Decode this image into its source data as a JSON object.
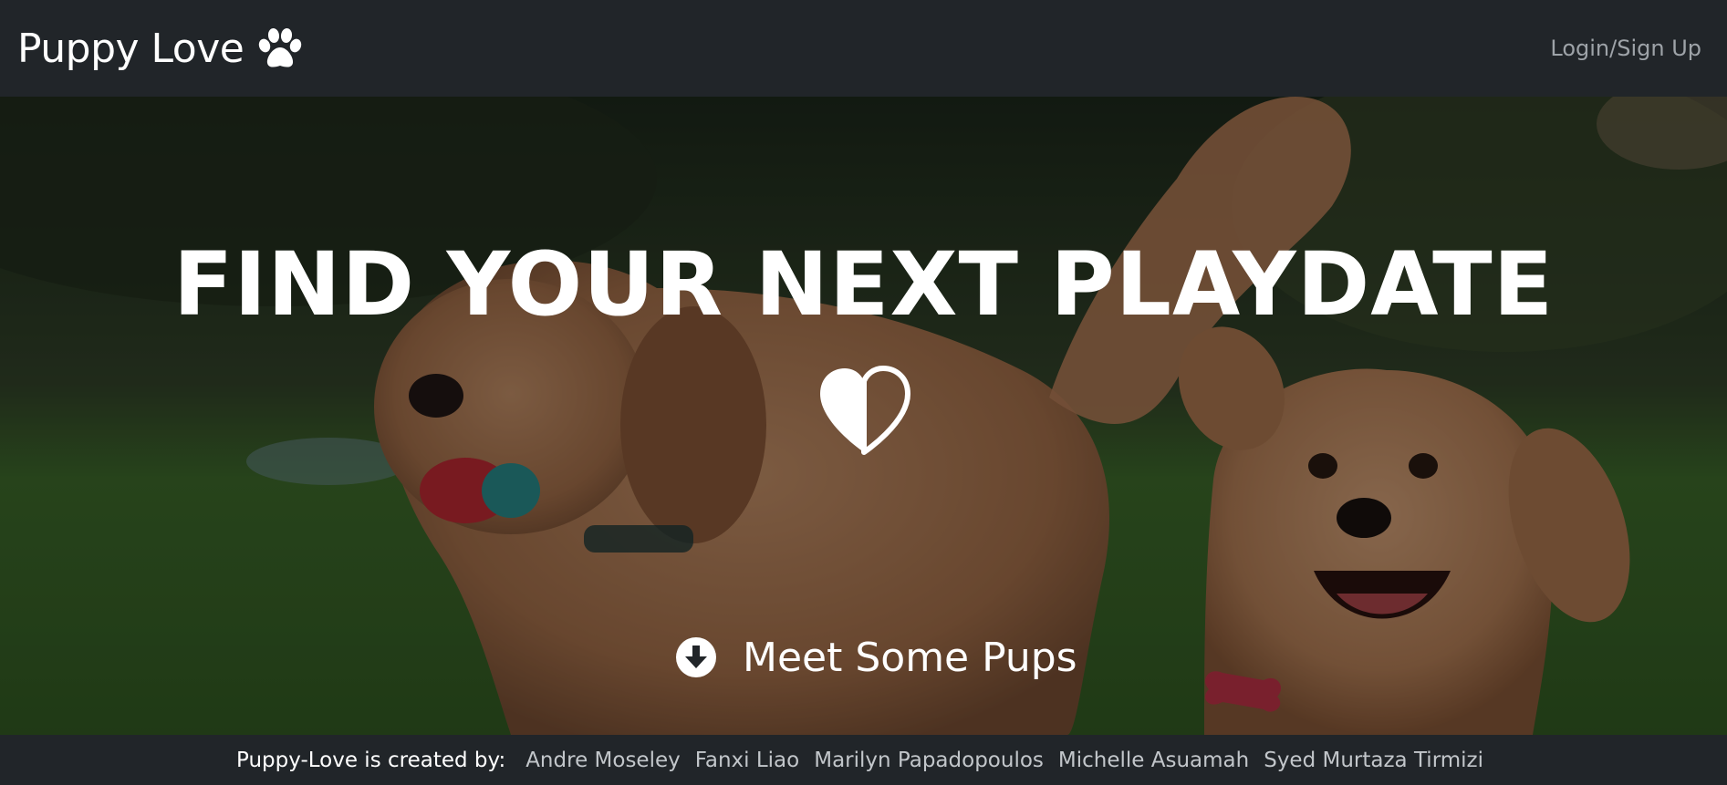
{
  "navbar": {
    "brand": "Puppy Love",
    "brand_icon": "paw-icon",
    "login_label": "Login/Sign Up"
  },
  "hero": {
    "title": "FIND YOUR NEXT PLAYDATE",
    "heart_icon": "half-heart-icon",
    "cta_icon": "arrow-down-circle-icon",
    "cta_label": "Meet Some Pups"
  },
  "footer": {
    "label": "Puppy-Love is created by:",
    "creators": [
      "Andre Moseley",
      "Fanxi Liao",
      "Marilyn Papadopoulos",
      "Michelle Asuamah",
      "Syed Murtaza Tirmizi"
    ]
  },
  "colors": {
    "navbar_bg": "#212529",
    "nav_link": "#9ea3a8",
    "footer_link": "#c2c6ca",
    "text": "#ffffff"
  }
}
